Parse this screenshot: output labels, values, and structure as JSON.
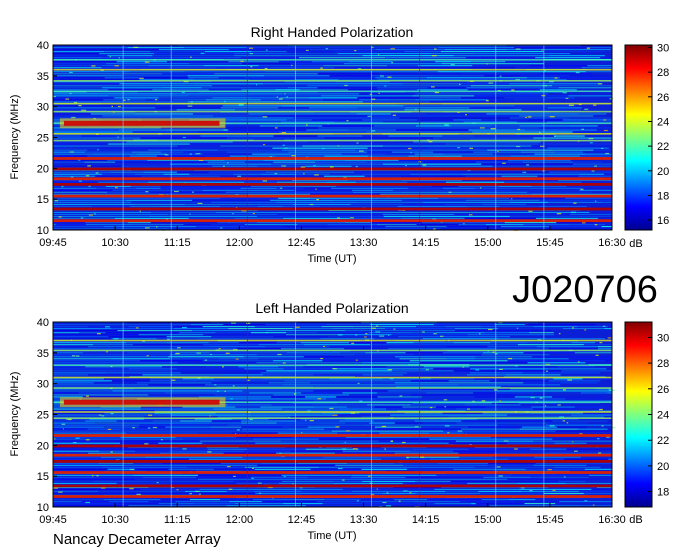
{
  "big_label": "J020706",
  "footer": "Nancay Decameter Array",
  "chart_data": [
    {
      "type": "heatmap",
      "title": "Right Handed Polarization",
      "xlabel": "Time (UT)",
      "ylabel": "Frequency (MHz)",
      "x_ticks": [
        "09:45",
        "10:30",
        "11:15",
        "12:00",
        "12:45",
        "13:30",
        "14:15",
        "15:00",
        "15:45",
        "16:30"
      ],
      "x_range": [
        "09:45",
        "16:30"
      ],
      "y_ticks": [
        10,
        15,
        20,
        25,
        30,
        35,
        40
      ],
      "ylim": [
        10,
        40
      ],
      "colorbar": {
        "ticks": [
          16,
          18,
          20,
          22,
          24,
          26,
          28,
          30
        ],
        "range": [
          15.2,
          30.2
        ],
        "unit": "dB"
      },
      "bands_mhz": [
        11.5,
        13.4,
        15.5,
        17.4,
        18.3,
        19.9,
        21.6,
        24.5,
        25.6,
        27.3,
        29.2,
        30.5,
        32.5,
        34.2,
        36.0,
        37.6
      ],
      "burst": {
        "time_start": "09:50",
        "time_end": "11:50",
        "freq_mhz": 27.3
      }
    },
    {
      "type": "heatmap",
      "title": "Left Handed Polarization",
      "xlabel": "Time (UT)",
      "ylabel": "Frequency (MHz)",
      "x_ticks": [
        "09:45",
        "10:30",
        "11:15",
        "12:00",
        "12:45",
        "13:30",
        "14:15",
        "15:00",
        "15:45",
        "16:30"
      ],
      "x_range": [
        "09:45",
        "16:30"
      ],
      "y_ticks": [
        10,
        15,
        20,
        25,
        30,
        35,
        40
      ],
      "ylim": [
        10,
        40
      ],
      "colorbar": {
        "ticks": [
          18,
          20,
          22,
          24,
          26,
          28,
          30
        ],
        "range": [
          16.8,
          31.2
        ],
        "unit": "dB"
      },
      "bands_mhz": [
        11.7,
        13.4,
        15.6,
        17.4,
        18.4,
        19.9,
        21.6,
        24.4,
        25.4,
        27.0,
        29.3,
        31.0,
        33.0,
        35.4,
        37.0
      ],
      "burst": {
        "time_start": "09:50",
        "time_end": "11:50",
        "freq_mhz": 27.0
      }
    }
  ]
}
